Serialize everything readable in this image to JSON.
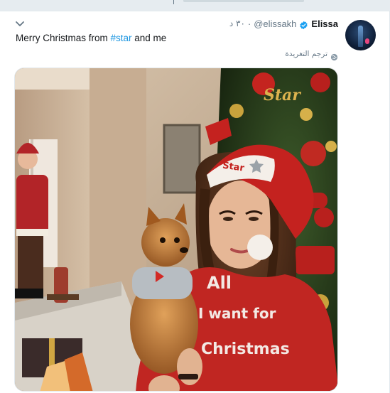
{
  "tweet": {
    "display_name": "Elissa",
    "handle": "@elissakh",
    "separator": "·",
    "timestamp": "٣٠ د",
    "text_before": "Merry Christmas from ",
    "hashtag": "#star",
    "text_after": " and me",
    "translate_label": "ترجم التغريدة"
  },
  "media": {
    "hat_text": "Star",
    "tree_text": "Star",
    "sweater_lines": [
      "All",
      "I want for",
      "Christmas"
    ]
  },
  "colors": {
    "link": "#1b95e0",
    "verified": "#1da1f2",
    "secondary_text": "#657786",
    "border": "#e1e8ed"
  },
  "icons": [
    "chevron-down-icon",
    "verified-badge-icon",
    "globe-icon"
  ]
}
